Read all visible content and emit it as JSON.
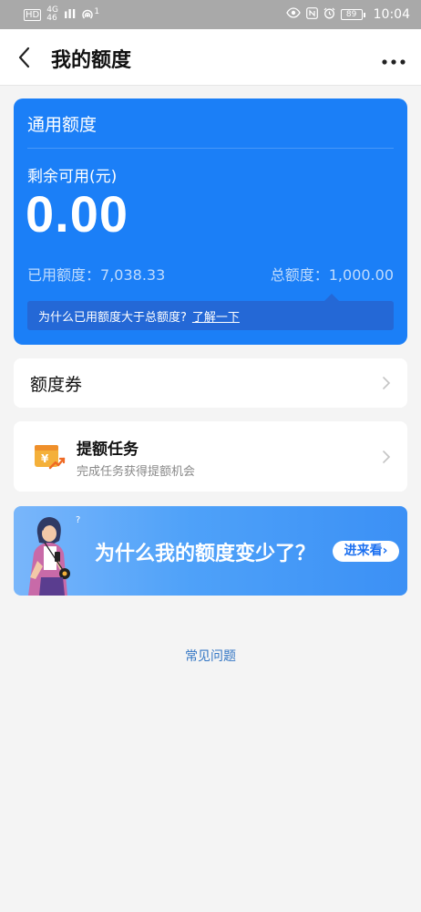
{
  "status_bar": {
    "left_badge": "HD",
    "network": "4G",
    "network_sub": "46",
    "signal": "ıll",
    "hotspot": "1",
    "battery": "89",
    "time": "10:04"
  },
  "header": {
    "title": "我的额度"
  },
  "quota_card": {
    "title": "通用额度",
    "remain_label": "剩余可用(元)",
    "remain_value": "0.00",
    "used_label": "已用额度：",
    "used_value": "7,038.33",
    "total_label": "总额度：",
    "total_value": "1,000.00",
    "info_text": "为什么已用额度大于总额度?",
    "info_link": "了解一下",
    "color": "#1b7ff7"
  },
  "coupon": {
    "label": "额度券"
  },
  "task": {
    "title": "提额任务",
    "subtitle": "完成任务获得提额机会",
    "icon_name": "wallet-yuan-icon"
  },
  "banner": {
    "text": "为什么我的额度变少了？",
    "button_label": "进来看",
    "button_chevron": "›"
  },
  "faq": {
    "label": "常见问题"
  }
}
